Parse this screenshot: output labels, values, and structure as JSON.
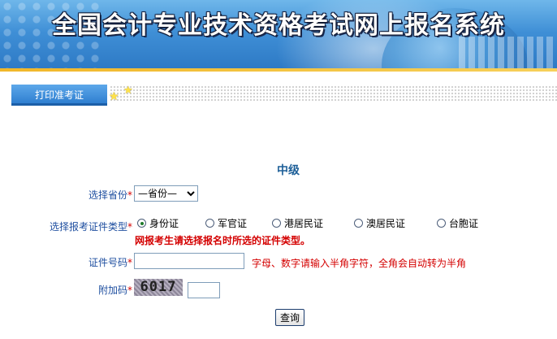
{
  "banner": {
    "title": "全国会计专业技术资格考试网上报名系统"
  },
  "tabs": {
    "print_ticket": "打印准考证"
  },
  "form": {
    "level": "中级",
    "province_label": "选择省份",
    "province_selected": "—省份—",
    "id_type_label": "选择报考证件类型",
    "id_types": [
      "身份证",
      "军官证",
      "港居民证",
      "澳居民证",
      "台胞证"
    ],
    "id_type_selected": "身份证",
    "warning": "网报考生请选择报名时所选的证件类型。",
    "id_number_label": "证件号码",
    "id_number_value": "",
    "id_number_hint": "字母、数字请输入半角字符，全角会自动转为半角",
    "captcha_label": "附加码",
    "captcha_code": "6017",
    "captcha_value": "",
    "required_mark": "*",
    "submit_label": "查询"
  },
  "colors": {
    "label": "#1f4fa0",
    "required": "#d40000",
    "title": "#1d5f98",
    "tab": "#2f7fd0"
  }
}
